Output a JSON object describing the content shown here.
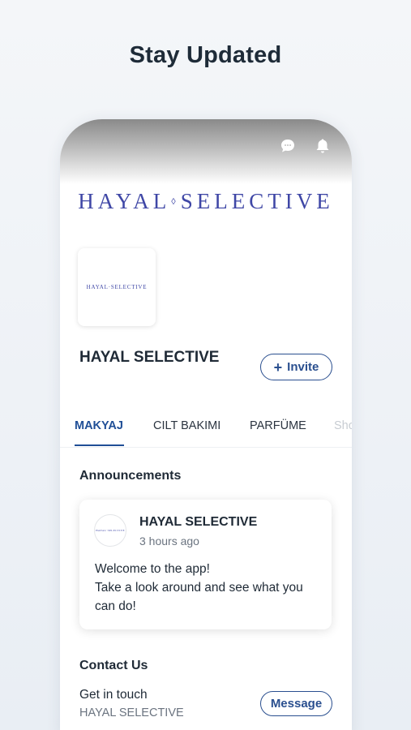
{
  "headline": "Stay Updated",
  "topbar": {
    "chat_icon": "chat-bubble-icon",
    "bell_icon": "bell-icon"
  },
  "cover": {
    "logo_left": "HAYAL",
    "logo_right": "SELECTIVE",
    "logo_separator": "◊"
  },
  "profile": {
    "avatar_text": "HAYAL·SELECTIVE",
    "name": "HAYAL SELECTIVE",
    "invite_label": "Invite"
  },
  "tabs": [
    {
      "label": "MAKYAJ",
      "active": true
    },
    {
      "label": "CILT BAKIMI",
      "active": false
    },
    {
      "label": "PARFÜME",
      "active": false
    },
    {
      "label": "Sho",
      "active": false
    }
  ],
  "announcements": {
    "title": "Announcements",
    "author": "HAYAL SELECTIVE",
    "time": "3 hours ago",
    "avatar_text": "HAYAL·SELECTIVE",
    "body_line1": "Welcome to the app!",
    "body_line2": "Take a look around and see what you can do!"
  },
  "contact": {
    "title": "Contact Us",
    "line1": "Get in touch",
    "line2": "HAYAL SELECTIVE",
    "message_label": "Message"
  },
  "colors": {
    "accent": "#2a4f8f",
    "brand_logo": "#3f47a6",
    "tab_active": "#1f4e96"
  }
}
